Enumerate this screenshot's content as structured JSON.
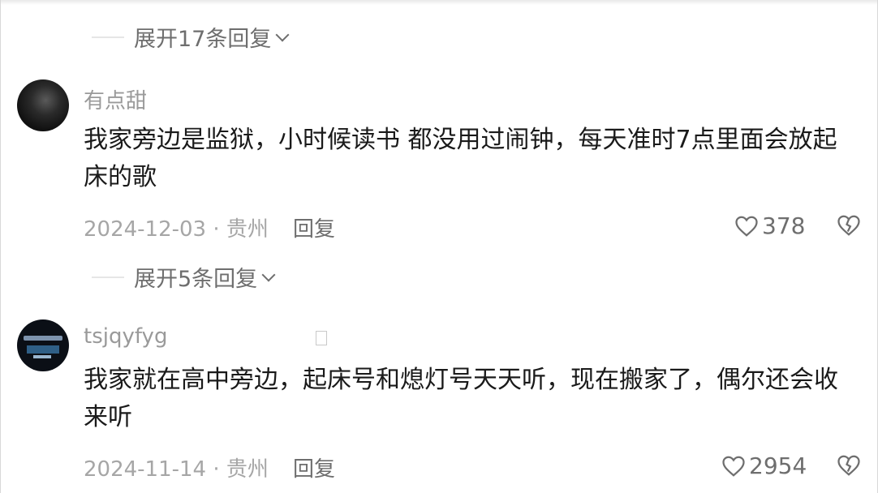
{
  "top_expand": {
    "label": "展开17条回复"
  },
  "comments": [
    {
      "username": "有点甜",
      "text": "我家旁边是监狱，小时候读书 都没用过闹钟，每天准时7点里面会放起床的歌",
      "date_location": "2024-12-03 · 贵州",
      "reply_label": "回复",
      "likes": "378",
      "expand_label": "展开5条回复"
    },
    {
      "username": "tsjqyfyg",
      "text": "我家就在高中旁边，起床号和熄灯号天天听，现在搬家了，偶尔还会收来听",
      "date_location": "2024-11-14 · 贵州",
      "reply_label": "回复",
      "likes": "2954"
    }
  ]
}
